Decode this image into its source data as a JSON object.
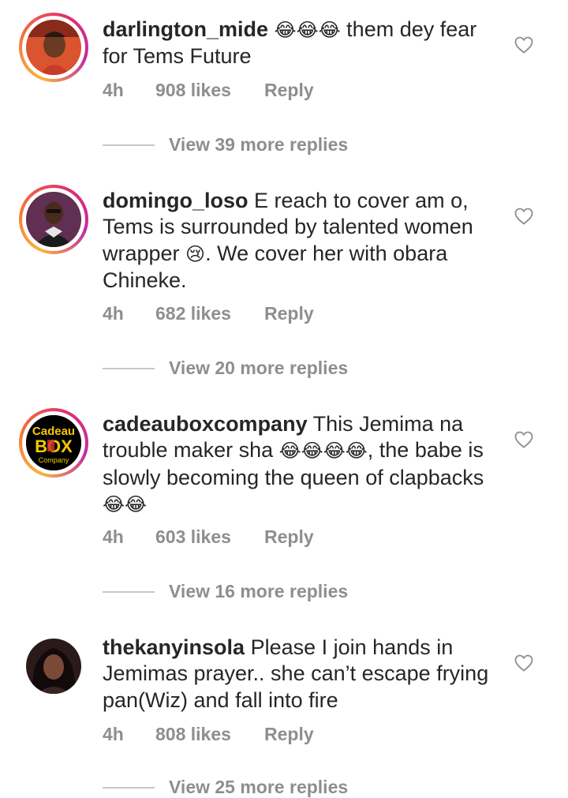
{
  "comments": [
    {
      "username": "darlington_mide",
      "text_parts": [
        "😂😂😂",
        " them dey fear for Tems Future"
      ],
      "time": "4h",
      "likes": "908 likes",
      "reply": "Reply",
      "view_replies": "View 39 more replies",
      "avatar": "photo-man-red"
    },
    {
      "username": "domingo_loso",
      "text_parts": [
        "E reach to cover am o, Tems is surrounded by talented women wrapper ",
        "😢",
        ". We cover her with obara Chineke."
      ],
      "time": "4h",
      "likes": "682 likes",
      "reply": "Reply",
      "view_replies": "View 20 more replies",
      "avatar": "photo-man-suit"
    },
    {
      "username": "cadeauboxcompany",
      "text_parts": [
        "This Jemima na trouble maker sha ",
        "😂😂😂😂",
        ", the babe is slowly becoming the queen of clapbacks ",
        "😂😂"
      ],
      "time": "4h",
      "likes": "603 likes",
      "reply": "Reply",
      "view_replies": "View 16 more replies",
      "avatar_logo": {
        "line1": "Cadeau",
        "line2": "BOX",
        "line3": "Company"
      }
    },
    {
      "username": "thekanyinsola",
      "text_parts": [
        "Please I join hands in Jemimas prayer.. she can’t escape frying pan(Wiz) and fall into fire"
      ],
      "time": "4h",
      "likes": "808 likes",
      "reply": "Reply",
      "view_replies": "View 25 more replies",
      "avatar": "photo-woman"
    }
  ],
  "icons": {
    "like": "heart-outline-icon"
  },
  "colors": {
    "text": "#262626",
    "muted": "#8e8e8e",
    "divider": "#c7c7c7"
  }
}
